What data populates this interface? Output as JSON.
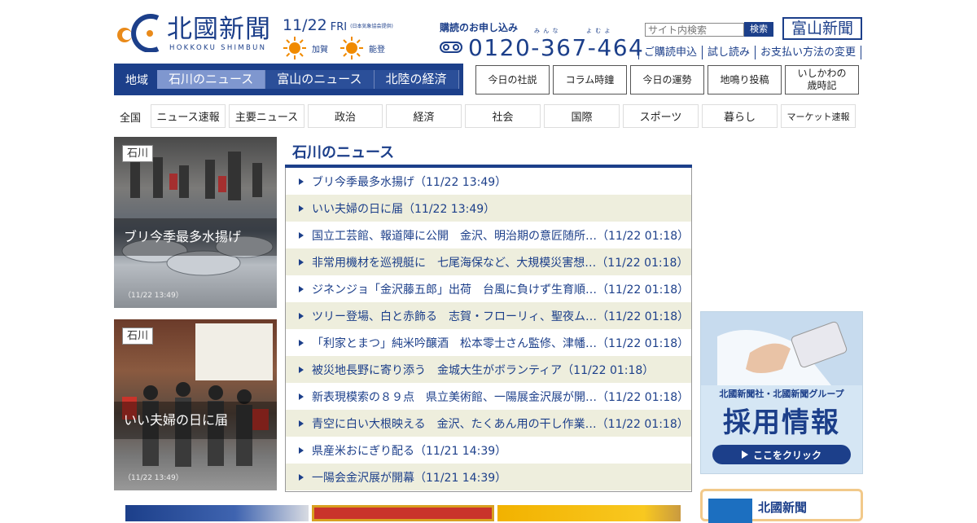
{
  "brand": {
    "logo_title": "北國新聞",
    "logo_sub": "HOKKOKU SHIMBUN"
  },
  "date": {
    "day": "11/22",
    "dow": "FRI",
    "source": "(日本気象協会提供)"
  },
  "weather": [
    {
      "city": "加賀",
      "icon": "sun-icon"
    },
    {
      "city": "能登",
      "icon": "sun-icon"
    }
  ],
  "subscribe": {
    "label": "購読のお申し込み",
    "ruby1": "み ん な",
    "ruby2": "よ む よ",
    "phone": "0120-367-464"
  },
  "search": {
    "placeholder": "サイト内検索",
    "button": "検索"
  },
  "toyama_button": "富山新聞",
  "util_links": [
    "ご購読申込",
    "試し読み",
    "お支払い方法の変更"
  ],
  "region_nav": {
    "label": "地域",
    "tabs": [
      "石川のニュース",
      "富山のニュース",
      "北陸の経済"
    ]
  },
  "feature_buttons": [
    "今日の社説",
    "コラム時鐘",
    "今日の運勢",
    "地鳴り投稿",
    "いしかわの\n歳時記"
  ],
  "categories": {
    "label": "全国",
    "items": [
      "ニュース速報",
      "主要ニュース",
      "政治",
      "経済",
      "社会",
      "国際",
      "スポーツ",
      "暮らし",
      "マーケット速報"
    ]
  },
  "cards": [
    {
      "tag": "石川",
      "title": "ブリ今季最多水揚げ",
      "time": "（11/22 13:49）"
    },
    {
      "tag": "石川",
      "title": "いい夫婦の日に届",
      "time": "（11/22 13:49）"
    }
  ],
  "news": {
    "title": "石川のニュース",
    "items": [
      "ブリ今季最多水揚げ（11/22 13:49）",
      "いい夫婦の日に届（11/22 13:49）",
      "国立工芸館、報道陣に公開　金沢、明治期の意匠随所…（11/22 01:18）",
      "非常用機材を巡視艇に　七尾海保など、大規模災害想…（11/22 01:18）",
      "ジネンジョ「金沢藤五郎」出荷　台風に負けず生育順…（11/22 01:18）",
      "ツリー登場、白と赤飾る　志賀・フローリィ、聖夜ム…（11/22 01:18）",
      "「利家とまつ」純米吟醸酒　松本零士さん監修、津幡…（11/22 01:18）",
      "被災地長野に寄り添う　金城大生がボランティア（11/22 01:18）",
      "新表現模索の８９点　県立美術館、一陽展金沢展が開…（11/22 01:18）",
      "青空に白い大根映える　金沢、たくあん用の干し作業…（11/22 01:18）",
      "県産米おにぎり配る（11/21 14:39）",
      "一陽会金沢展が開幕（11/21 14:39）"
    ]
  },
  "ad": {
    "sub": "北國新聞社・北國新聞グループ",
    "main": "採用情報",
    "button": "ここをクリック"
  },
  "bottom_box": {
    "title": "北國新聞"
  },
  "colors": {
    "brand_navy": "#1c3f8a",
    "accent_orange": "#f08a00",
    "stripe": "#eeeedd"
  }
}
